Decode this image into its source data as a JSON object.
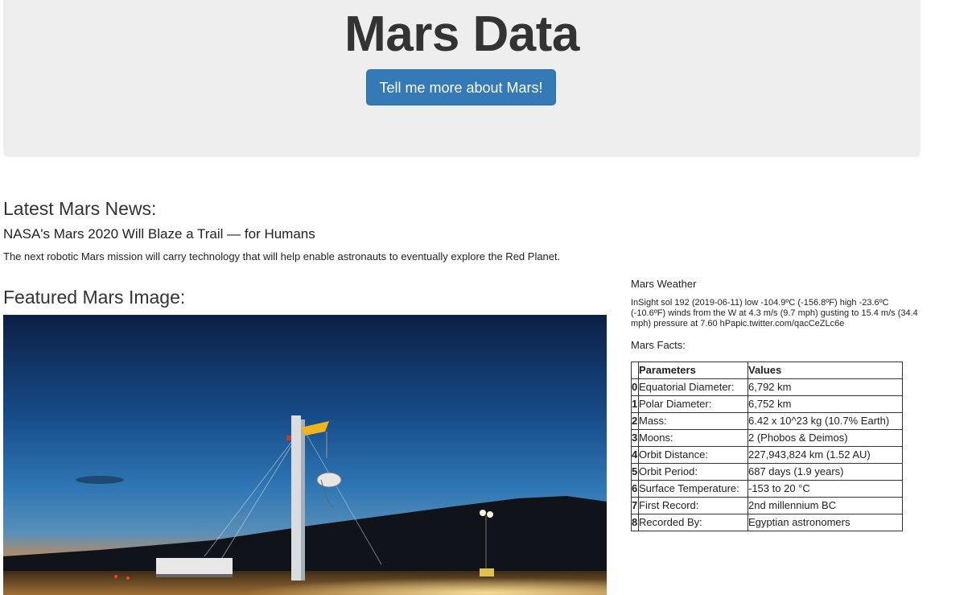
{
  "jumbotron": {
    "title": "Mars Data",
    "button_label": "Tell me more about Mars!"
  },
  "news": {
    "heading": "Latest Mars News:",
    "title": "NASA's Mars 2020 Will Blaze a Trail — for Humans",
    "teaser": "The next robotic Mars mission will carry technology that will help enable astronauts to eventually explore the Red Planet."
  },
  "featured": {
    "heading": "Featured Mars Image:",
    "image_subject": "test launch tower with parachute test vehicle at dusk"
  },
  "weather": {
    "heading": "Mars Weather",
    "text": "InSight sol 192 (2019-06-11) low -104.9ºC (-156.8ºF) high -23.6ºC (-10.6ºF) winds from the W at 4.3 m/s (9.7 mph) gusting to 15.4 m/s (34.4 mph) pressure at 7.60 hPapic.twitter.com/qacCeZLc6e"
  },
  "facts": {
    "heading": "Mars Facts:",
    "columns": [
      "",
      "Parameters",
      "Values"
    ],
    "rows": [
      {
        "index": "0",
        "parameter": "Equatorial Diameter:",
        "value": "6,792 km"
      },
      {
        "index": "1",
        "parameter": "Polar Diameter:",
        "value": "6,752 km"
      },
      {
        "index": "2",
        "parameter": "Mass:",
        "value": "6.42 x 10^23 kg (10.7% Earth)"
      },
      {
        "index": "3",
        "parameter": "Moons:",
        "value": "2 (Phobos & Deimos)"
      },
      {
        "index": "4",
        "parameter": "Orbit Distance:",
        "value": "227,943,824 km (1.52 AU)"
      },
      {
        "index": "5",
        "parameter": "Orbit Period:",
        "value": "687 days (1.9 years)"
      },
      {
        "index": "6",
        "parameter": "Surface Temperature:",
        "value": "-153 to 20 °C"
      },
      {
        "index": "7",
        "parameter": "First Record:",
        "value": "2nd millennium BC"
      },
      {
        "index": "8",
        "parameter": "Recorded By:",
        "value": "Egyptian astronomers"
      }
    ]
  },
  "colors": {
    "jumbotron_bg": "#eeeeee",
    "button_bg": "#337ab7",
    "text": "#333333"
  }
}
